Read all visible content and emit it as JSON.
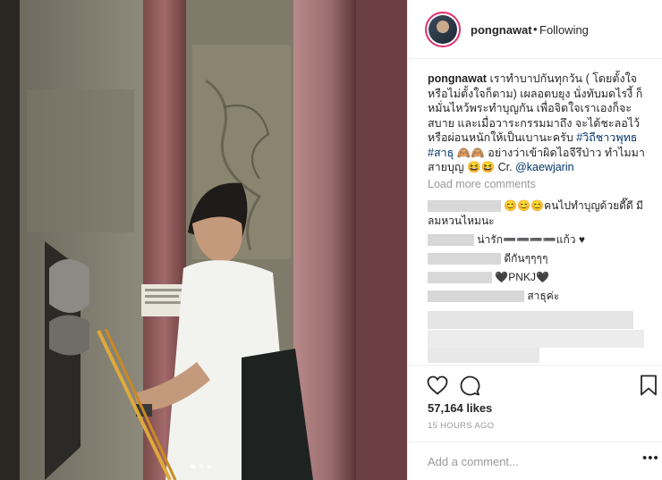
{
  "post": {
    "username": "pongnawat",
    "separator": "•",
    "follow_status": "Following",
    "caption_user": "pongnawat",
    "caption_text": "เราทำบาปกันทุกวัน ( โดยตั้งใจ หรือไม่ตั้งใจก็ตาม) เผลอตบยุง นั่งทับมดไรงี้ ก็ หมั่นไหว้พระทำบุญกัน เพื่อจิตใจเราเองก็จะ สบาย และเมื่อวาระกรรมมาถึง จะได้ชะลอไว้ หรือผ่อนหนักให้เป็นเบานะครับ ",
    "hashtag1": "#วิถีชาวพุทธ",
    "hashtag2": "#สาธุ",
    "caption_tail": " 🙈🙈 อย่างว่าเข้าผิดไอจีรึป่าว ทำไมมา สายบุญ 😆😆 Cr. ",
    "mention": "@kaewjarin",
    "load_more": "Load more comments",
    "comments": [
      {
        "text": "😊😊😊คนไปทำบุญด้วยดี๊ดี มี",
        "text2": "ลมหวนไหมนะ"
      },
      {
        "text": "น่ารัก➖➖➖➖แก้ว ♥"
      },
      {
        "text": "ดีกันๆๆๆๆ"
      },
      {
        "text": "🖤PNKJ🖤"
      },
      {
        "text": "สาธุค่ะ"
      }
    ],
    "likes": "57,164 likes",
    "time": "15 HOURS AGO",
    "add_comment_placeholder": "Add a comment...",
    "more_options": "•••"
  },
  "icons": {
    "like": "heart-icon",
    "comment": "comment-icon",
    "save": "bookmark-icon"
  },
  "carousel": {
    "total": 3,
    "active": 1
  }
}
